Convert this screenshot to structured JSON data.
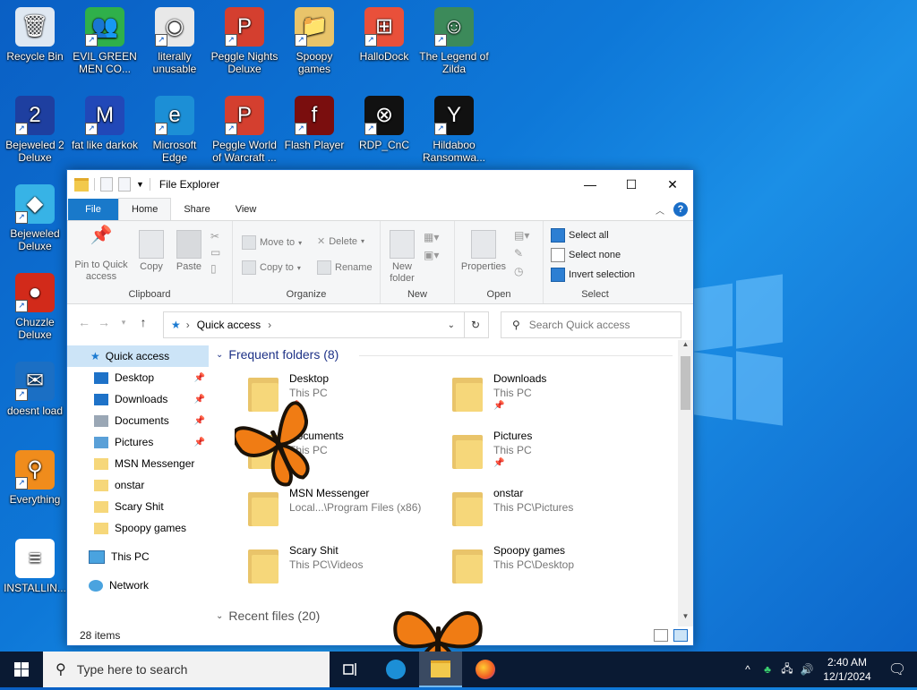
{
  "desktop": {
    "icons": [
      {
        "label": "Recycle Bin",
        "color": "#dfe8f2",
        "glyph": "🗑"
      },
      {
        "label": "EVIL GREEN MEN CO...",
        "color": "#2fb04a",
        "glyph": "👥"
      },
      {
        "label": "literally unusable",
        "color": "#e8e8e8",
        "glyph": "◉"
      },
      {
        "label": "Peggle Nights Deluxe",
        "color": "#d43f2f",
        "glyph": "P"
      },
      {
        "label": "Spoopy games",
        "color": "#e9c46a",
        "glyph": "📁"
      },
      {
        "label": "HalloDock",
        "color": "#e9503a",
        "glyph": "⊞"
      },
      {
        "label": "The Legend of Zilda",
        "color": "#3c8a5a",
        "glyph": "☺"
      },
      {
        "label": "Bejeweled 2 Deluxe",
        "color": "#1e3fa0",
        "glyph": "2"
      },
      {
        "label": "fat like darkok",
        "color": "#2148b8",
        "glyph": "M"
      },
      {
        "label": "Microsoft Edge",
        "color": "#1c8fd6",
        "glyph": "e"
      },
      {
        "label": "Peggle World of Warcraft ...",
        "color": "#d43f2f",
        "glyph": "P"
      },
      {
        "label": "Flash Player",
        "color": "#7a0e0e",
        "glyph": "f"
      },
      {
        "label": "RDP_CnC",
        "color": "#111111",
        "glyph": "⊗"
      },
      {
        "label": "Hildaboo Ransomwa...",
        "color": "#111111",
        "glyph": "Y"
      },
      {
        "label": "Bejeweled Deluxe",
        "color": "#37b3e6",
        "glyph": "◆"
      },
      {
        "label": "Chuzzle Deluxe",
        "color": "#d22a1a",
        "glyph": "●"
      },
      {
        "label": "doesnt load",
        "color": "#1b6fc4",
        "glyph": "✉"
      },
      {
        "label": "Everything",
        "color": "#f08c1c",
        "glyph": "⚲"
      },
      {
        "label": "INSTALLIN...",
        "color": "#ffffff",
        "glyph": "≡"
      }
    ]
  },
  "window": {
    "title": "File Explorer",
    "controls": {
      "minimize": "—",
      "maximize": "☐",
      "close": "✕"
    },
    "tabs": [
      "File",
      "Home",
      "Share",
      "View"
    ],
    "ribbon": {
      "clipboard": {
        "label": "Clipboard",
        "pin": "Pin to Quick access",
        "copy": "Copy",
        "paste": "Paste"
      },
      "organize": {
        "label": "Organize",
        "move_to": "Move to",
        "copy_to": "Copy to",
        "delete": "Delete",
        "rename": "Rename"
      },
      "new": {
        "label": "New",
        "new_folder": "New folder"
      },
      "open": {
        "label": "Open",
        "properties": "Properties"
      },
      "select": {
        "label": "Select",
        "select_all": "Select all",
        "select_none": "Select none",
        "invert": "Invert selection"
      }
    },
    "address": {
      "path": "Quick access",
      "search_placeholder": "Search Quick access"
    },
    "nav": {
      "quick_access": "Quick access",
      "items": [
        {
          "label": "Desktop",
          "pinned": true,
          "icon": "#1e72c8"
        },
        {
          "label": "Downloads",
          "pinned": true,
          "icon": "#1e72c8"
        },
        {
          "label": "Documents",
          "pinned": true,
          "icon": "#9aa7b5"
        },
        {
          "label": "Pictures",
          "pinned": true,
          "icon": "#5aa0d8"
        },
        {
          "label": "MSN Messenger",
          "pinned": false,
          "icon": "#f6d77a"
        },
        {
          "label": "onstar",
          "pinned": false,
          "icon": "#f6d77a"
        },
        {
          "label": "Scary Shit",
          "pinned": false,
          "icon": "#f6d77a"
        },
        {
          "label": "Spoopy games",
          "pinned": false,
          "icon": "#f6d77a"
        }
      ],
      "this_pc": "This PC",
      "network": "Network"
    },
    "content": {
      "frequent_header": "Frequent folders (8)",
      "recent_header": "Recent files (20)",
      "folders": [
        {
          "name": "Desktop",
          "location": "This PC",
          "pinned": true
        },
        {
          "name": "Downloads",
          "location": "This PC",
          "pinned": true
        },
        {
          "name": "Documents",
          "location": "This PC",
          "pinned": true
        },
        {
          "name": "Pictures",
          "location": "This PC",
          "pinned": true
        },
        {
          "name": "MSN Messenger",
          "location": "Local...\\Program Files (x86)",
          "pinned": false
        },
        {
          "name": "onstar",
          "location": "This PC\\Pictures",
          "pinned": false
        },
        {
          "name": "Scary Shit",
          "location": "This PC\\Videos",
          "pinned": false
        },
        {
          "name": "Spoopy games",
          "location": "This PC\\Desktop",
          "pinned": false
        }
      ]
    },
    "status": {
      "items": "28 items"
    }
  },
  "taskbar": {
    "search_placeholder": "Type here to search",
    "time": "2:40 AM",
    "date": "12/1/2024",
    "tray": {
      "chevron": "^",
      "network": "🖧",
      "volume": "🔊",
      "notifications": "🗨"
    }
  }
}
